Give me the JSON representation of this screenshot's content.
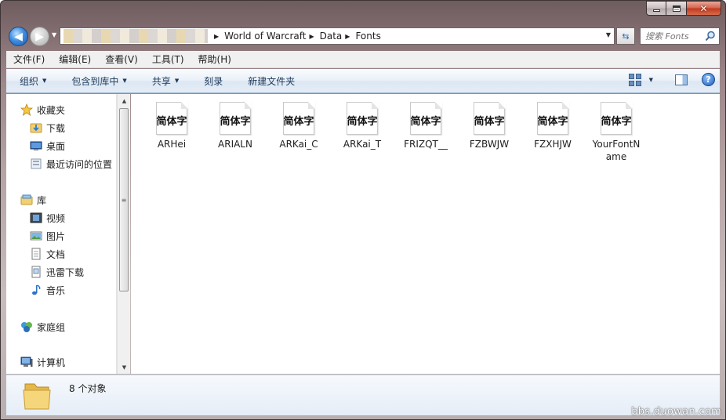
{
  "nav": {
    "breadcrumbs": [
      "World of Warcraft",
      "Data",
      "Fonts"
    ],
    "search_placeholder": "搜索 Fonts"
  },
  "menu": [
    "文件(F)",
    "编辑(E)",
    "查看(V)",
    "工具(T)",
    "帮助(H)"
  ],
  "commands": {
    "organize": "组织",
    "include_library": "包含到库中",
    "share": "共享",
    "burn": "刻录",
    "new_folder": "新建文件夹"
  },
  "sidebar": {
    "favorites": "收藏夹",
    "downloads": "下载",
    "desktop": "桌面",
    "recent": "最近访问的位置",
    "libraries": "库",
    "videos": "视频",
    "pictures": "图片",
    "documents": "文档",
    "thunder": "迅雷下载",
    "music": "音乐",
    "homegroup": "家庭组",
    "computer": "计算机"
  },
  "file_icon_text": "简体字",
  "files": [
    "ARHei",
    "ARIALN",
    "ARKai_C",
    "ARKai_T",
    "FRIZQT__",
    "FZBWJW",
    "FZXHJW",
    "YourFontName"
  ],
  "status": {
    "count": "8 个对象"
  },
  "watermark": "bbs.duowan.com",
  "colors": {
    "accent": "#1e395b",
    "frame": "#9b8588"
  }
}
